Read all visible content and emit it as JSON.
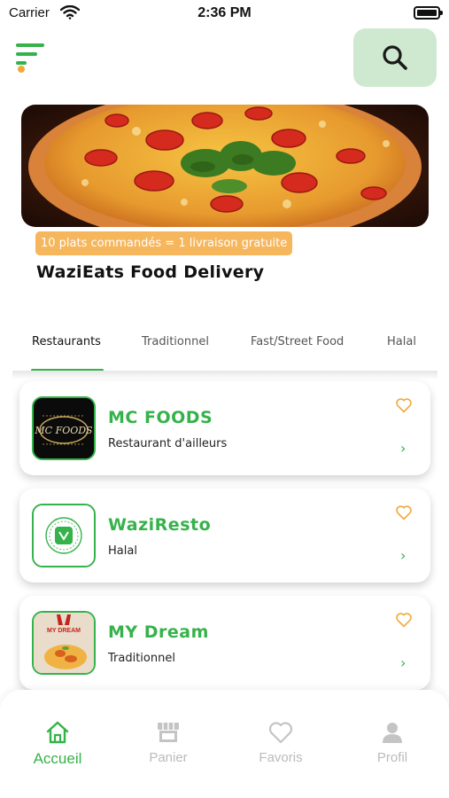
{
  "status_bar": {
    "carrier": "Carrier",
    "time": "2:36 PM"
  },
  "header": {
    "menu_icon": "menu-icon",
    "search_icon": "search-icon"
  },
  "banner": {
    "image": "pizza-photo",
    "promo": "10 plats commandés = 1 livraison gratuite"
  },
  "title": "WaziEats Food Delivery",
  "tabs": [
    {
      "label": "Restaurants",
      "active": true
    },
    {
      "label": "Traditionnel"
    },
    {
      "label": "Fast/Street Food"
    },
    {
      "label": "Halal"
    }
  ],
  "restaurants": [
    {
      "name": "MC FOODS",
      "category": "Restaurant d'ailleurs",
      "logo_text": "MC FOODS"
    },
    {
      "name": "WaziResto",
      "category": "Halal"
    },
    {
      "name": "MY Dream",
      "category": "Traditionnel",
      "logo_text": "MY DREAM"
    }
  ],
  "bottom_nav": [
    {
      "label": "Accueil",
      "icon": "home-icon",
      "active": true
    },
    {
      "label": "Panier",
      "icon": "store-icon"
    },
    {
      "label": "Favoris",
      "icon": "heart-icon"
    },
    {
      "label": "Profil",
      "icon": "person-icon"
    }
  ],
  "colors": {
    "accent": "#36b24a",
    "promo": "#f6b65c",
    "search_bg": "#cfe9d1",
    "heart": "#f2a93b",
    "inactive": "#bbbbbb"
  }
}
